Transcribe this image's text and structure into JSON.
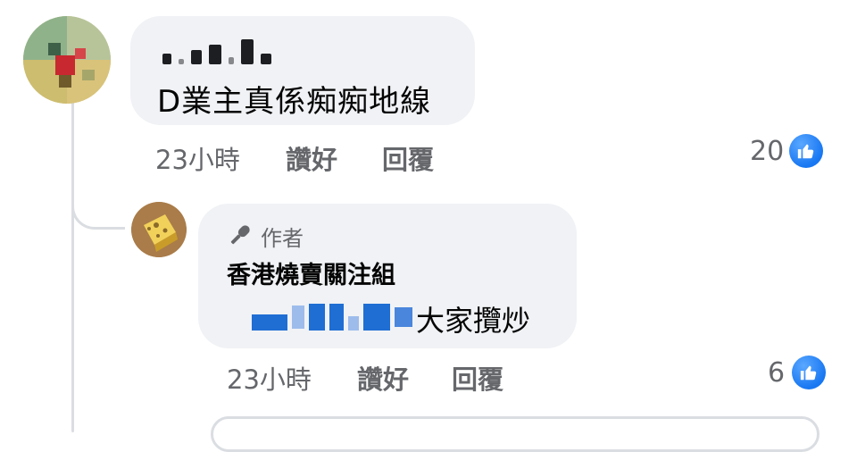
{
  "comment1": {
    "text": "D業主真係痴痴地線",
    "time": "23小時",
    "like_action": "讚好",
    "reply_action": "回覆",
    "like_count": "20"
  },
  "comment2": {
    "author_badge": "作者",
    "author_name": "香港燒賣關注組",
    "text": "大家攬炒",
    "time": "23小時",
    "like_action": "讚好",
    "reply_action": "回覆",
    "like_count": "6"
  },
  "icons": {
    "like": "thumbs-up-icon",
    "author_badge": "microphone-icon"
  },
  "colors": {
    "bubble": "#f0f2f5",
    "meta_text": "#65676b",
    "like_blue": "#1877f2",
    "mention_blue": "#1f6ed4"
  }
}
